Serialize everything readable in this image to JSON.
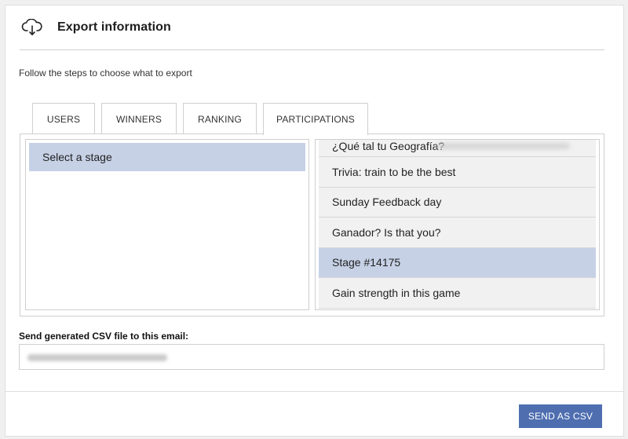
{
  "header": {
    "title": "Export information",
    "icon": "cloud-download-icon"
  },
  "intro": "Follow the steps to choose what to export",
  "tabs": [
    {
      "label": "USERS",
      "active": false
    },
    {
      "label": "WINNERS",
      "active": false
    },
    {
      "label": "RANKING",
      "active": false
    },
    {
      "label": "PARTICIPATIONS",
      "active": true
    }
  ],
  "left_list": {
    "items": [
      {
        "label": "Select a stage",
        "selected": true
      }
    ]
  },
  "right_list": {
    "items": [
      {
        "label": "¿Qué tal tu Geografía?",
        "selected": false
      },
      {
        "label": "Trivia: train to be the best",
        "selected": false
      },
      {
        "label": "Sunday Feedback day",
        "selected": false
      },
      {
        "label": "Ganador? Is that you?",
        "selected": false
      },
      {
        "label": "Stage #14175",
        "selected": true
      },
      {
        "label": "Gain strength in this game",
        "selected": false
      }
    ]
  },
  "email": {
    "label": "Send generated CSV file to this email:",
    "value": ""
  },
  "actions": {
    "send_label": "SEND AS CSV"
  },
  "colors": {
    "accent": "#4e6eb0",
    "selected": "#c6d1e6",
    "row_bg": "#f1f1f1"
  }
}
